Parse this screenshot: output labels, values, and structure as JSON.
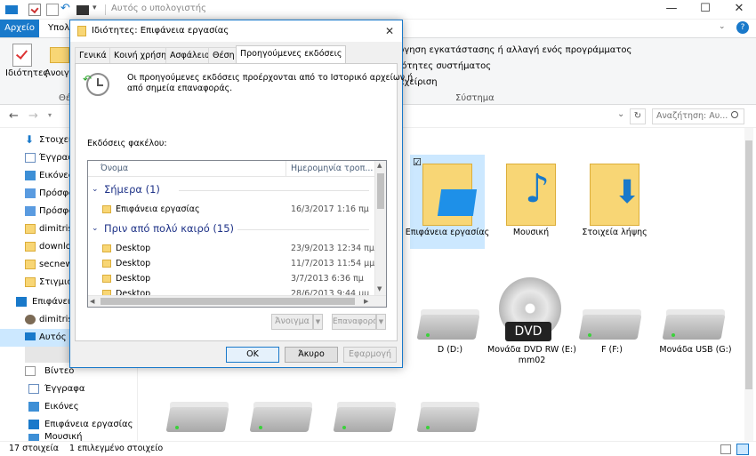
{
  "window": {
    "title": "Αυτός ο υπολογιστής",
    "minimize": "—",
    "maximize": "☐",
    "close": "✕",
    "help": "?"
  },
  "ribbon": {
    "tab_file": "Αρχείο",
    "tab_computer": "Υπολ",
    "btn_properties": "Ιδιότητες",
    "btn_open": "Ανοιγμ",
    "group_label_partial": "Θέ",
    "system_items": [
      "αρχής / Απεγκατάσταση ή αλλαγή ενός προγράμματος",
      "ιδιότητες συστήματος",
      "Διαχείριση"
    ],
    "system_items_visible": [
      "ργηση εγκατάστασης ή αλλαγή ενός προγράμματος",
      "ιότητες συστήματος",
      "αχείριση"
    ],
    "system_group": "Σύστημα"
  },
  "address": {
    "search_placeholder": "Αναζήτηση: Αυ...",
    "refresh": "↻",
    "dropdown": "⌄"
  },
  "navpane": {
    "items": [
      {
        "label": "Στοιχεία",
        "icon": "download-arrow-icon"
      },
      {
        "label": "Έγγραφ",
        "icon": "document-icon"
      },
      {
        "label": "Εικόνες",
        "icon": "pictures-icon"
      },
      {
        "label": "Πρόσφα",
        "icon": "recent-icon"
      },
      {
        "label": "Πρόσφα",
        "icon": "recent-icon"
      },
      {
        "label": "dimitris",
        "icon": "folder-icon"
      },
      {
        "label": "downlo",
        "icon": "folder-icon"
      },
      {
        "label": "secnews",
        "icon": "folder-icon"
      },
      {
        "label": "Στιγμιότ",
        "icon": "folder-icon"
      },
      {
        "label": "Επιφάνει",
        "icon": "desktop-icon"
      },
      {
        "label": "dimitris",
        "icon": "user-icon"
      },
      {
        "label": "Αυτός ο",
        "icon": "computer-icon"
      },
      {
        "label": "",
        "icon": ""
      },
      {
        "label": "Βίντεο",
        "icon": "video-icon"
      },
      {
        "label": "Έγγραφα",
        "icon": "document-icon"
      },
      {
        "label": "Εικόνες",
        "icon": "pictures-icon"
      },
      {
        "label": "Επιφάνεια εργασίας",
        "icon": "desktop-icon"
      },
      {
        "label": "Μουσική",
        "icon": "music-icon"
      }
    ]
  },
  "content": {
    "folders": [
      {
        "label": "Επιφάνεια εργασίας",
        "selected": true,
        "checkbox": "☑"
      },
      {
        "label": "Μουσική"
      },
      {
        "label": "Στοιχεία λήψης"
      }
    ],
    "drives": [
      {
        "label": "D (D:)"
      },
      {
        "label": "Μονάδα DVD RW (E:) mm02",
        "badge": "DVD"
      },
      {
        "label": "F (F:)"
      },
      {
        "label": "Μονάδα USB (G:)"
      }
    ]
  },
  "status": {
    "count": "17 στοιχεία",
    "selected": "1 επιλεγμένο στοιχείο"
  },
  "dialog": {
    "title": "Ιδιότητες: Επιφάνεια εργασίας",
    "close": "✕",
    "tabs": [
      "Γενικά",
      "Κοινή χρήση",
      "Ασφάλεια",
      "Θέση",
      "Προηγούμενες εκδόσεις"
    ],
    "active_tab": "Προηγούμενες εκδόσεις",
    "info_text_1": "Οι προηγούμενες εκδόσεις προέρχονται από το Ιστορικό αρχείων ή",
    "info_text_2": "από σημεία επαναφοράς.",
    "versions_label": "Εκδόσεις φακέλου:",
    "col_name": "Όνομα",
    "col_date": "Ημερομηνία τροπ...",
    "groups": [
      {
        "header": "Σήμερα (1)",
        "rows": [
          {
            "name": "Επιφάνεια εργασίας",
            "date": "16/3/2017 1:16 πμ"
          }
        ]
      },
      {
        "header": "Πριν από πολύ καιρό (15)",
        "rows": [
          {
            "name": "Desktop",
            "date": "23/9/2013 12:34 πμ"
          },
          {
            "name": "Desktop",
            "date": "11/7/2013 11:54 μμ"
          },
          {
            "name": "Desktop",
            "date": "3/7/2013 6:36 πμ"
          },
          {
            "name": "Desktop",
            "date": "28/6/2013 9:44 μμ"
          }
        ]
      }
    ],
    "btn_open": "Άνοιγμα",
    "btn_restore": "Επαναφορά",
    "btn_ok": "OK",
    "btn_cancel": "Άκυρο",
    "btn_apply": "Εφαρμογή"
  },
  "colors": {
    "accent": "#1979ca",
    "folder": "#f8d675",
    "selection": "#cce8ff"
  }
}
